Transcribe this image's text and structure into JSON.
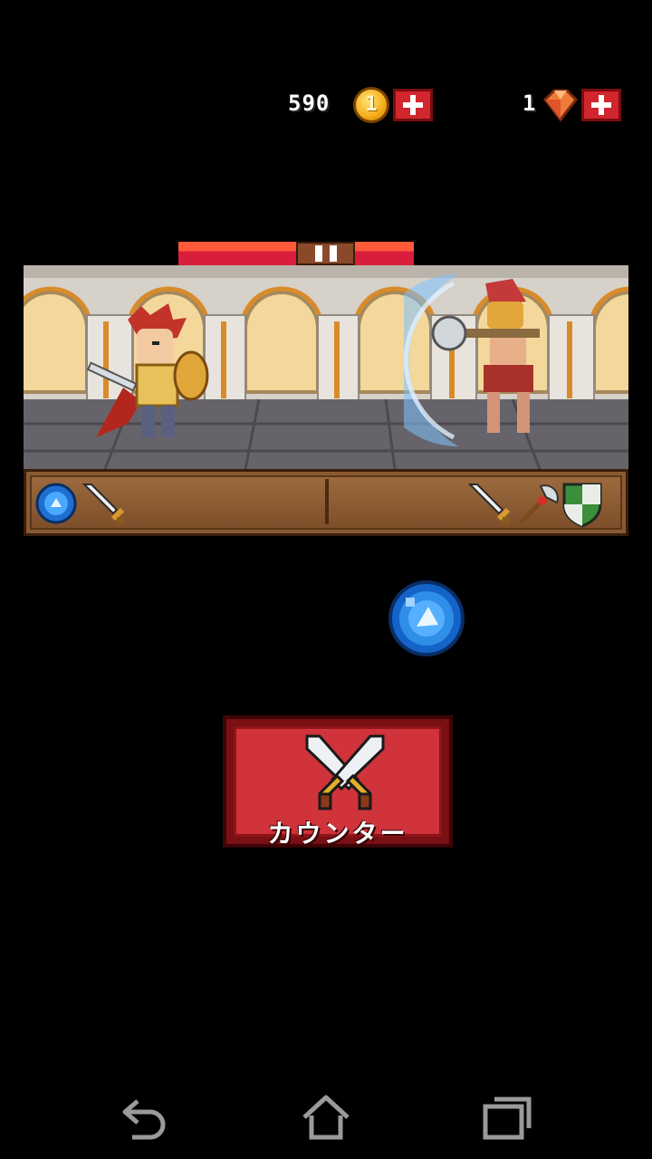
{
  "currency": {
    "coins": "590",
    "coin_symbol": "1",
    "gems": "1"
  },
  "colors": {
    "hp": "#e0283c",
    "button": "#d0333a",
    "orb": "#2f8ee8"
  },
  "player_skills": [
    "water-orb-icon",
    "sword-icon"
  ],
  "enemy_skills": [
    "sword-icon",
    "axe-icon",
    "shield-icon"
  ],
  "action_button": {
    "label": "カウンター",
    "icon": "crossed-swords-icon"
  },
  "nav": [
    "back-icon",
    "home-icon",
    "recent-apps-icon"
  ]
}
